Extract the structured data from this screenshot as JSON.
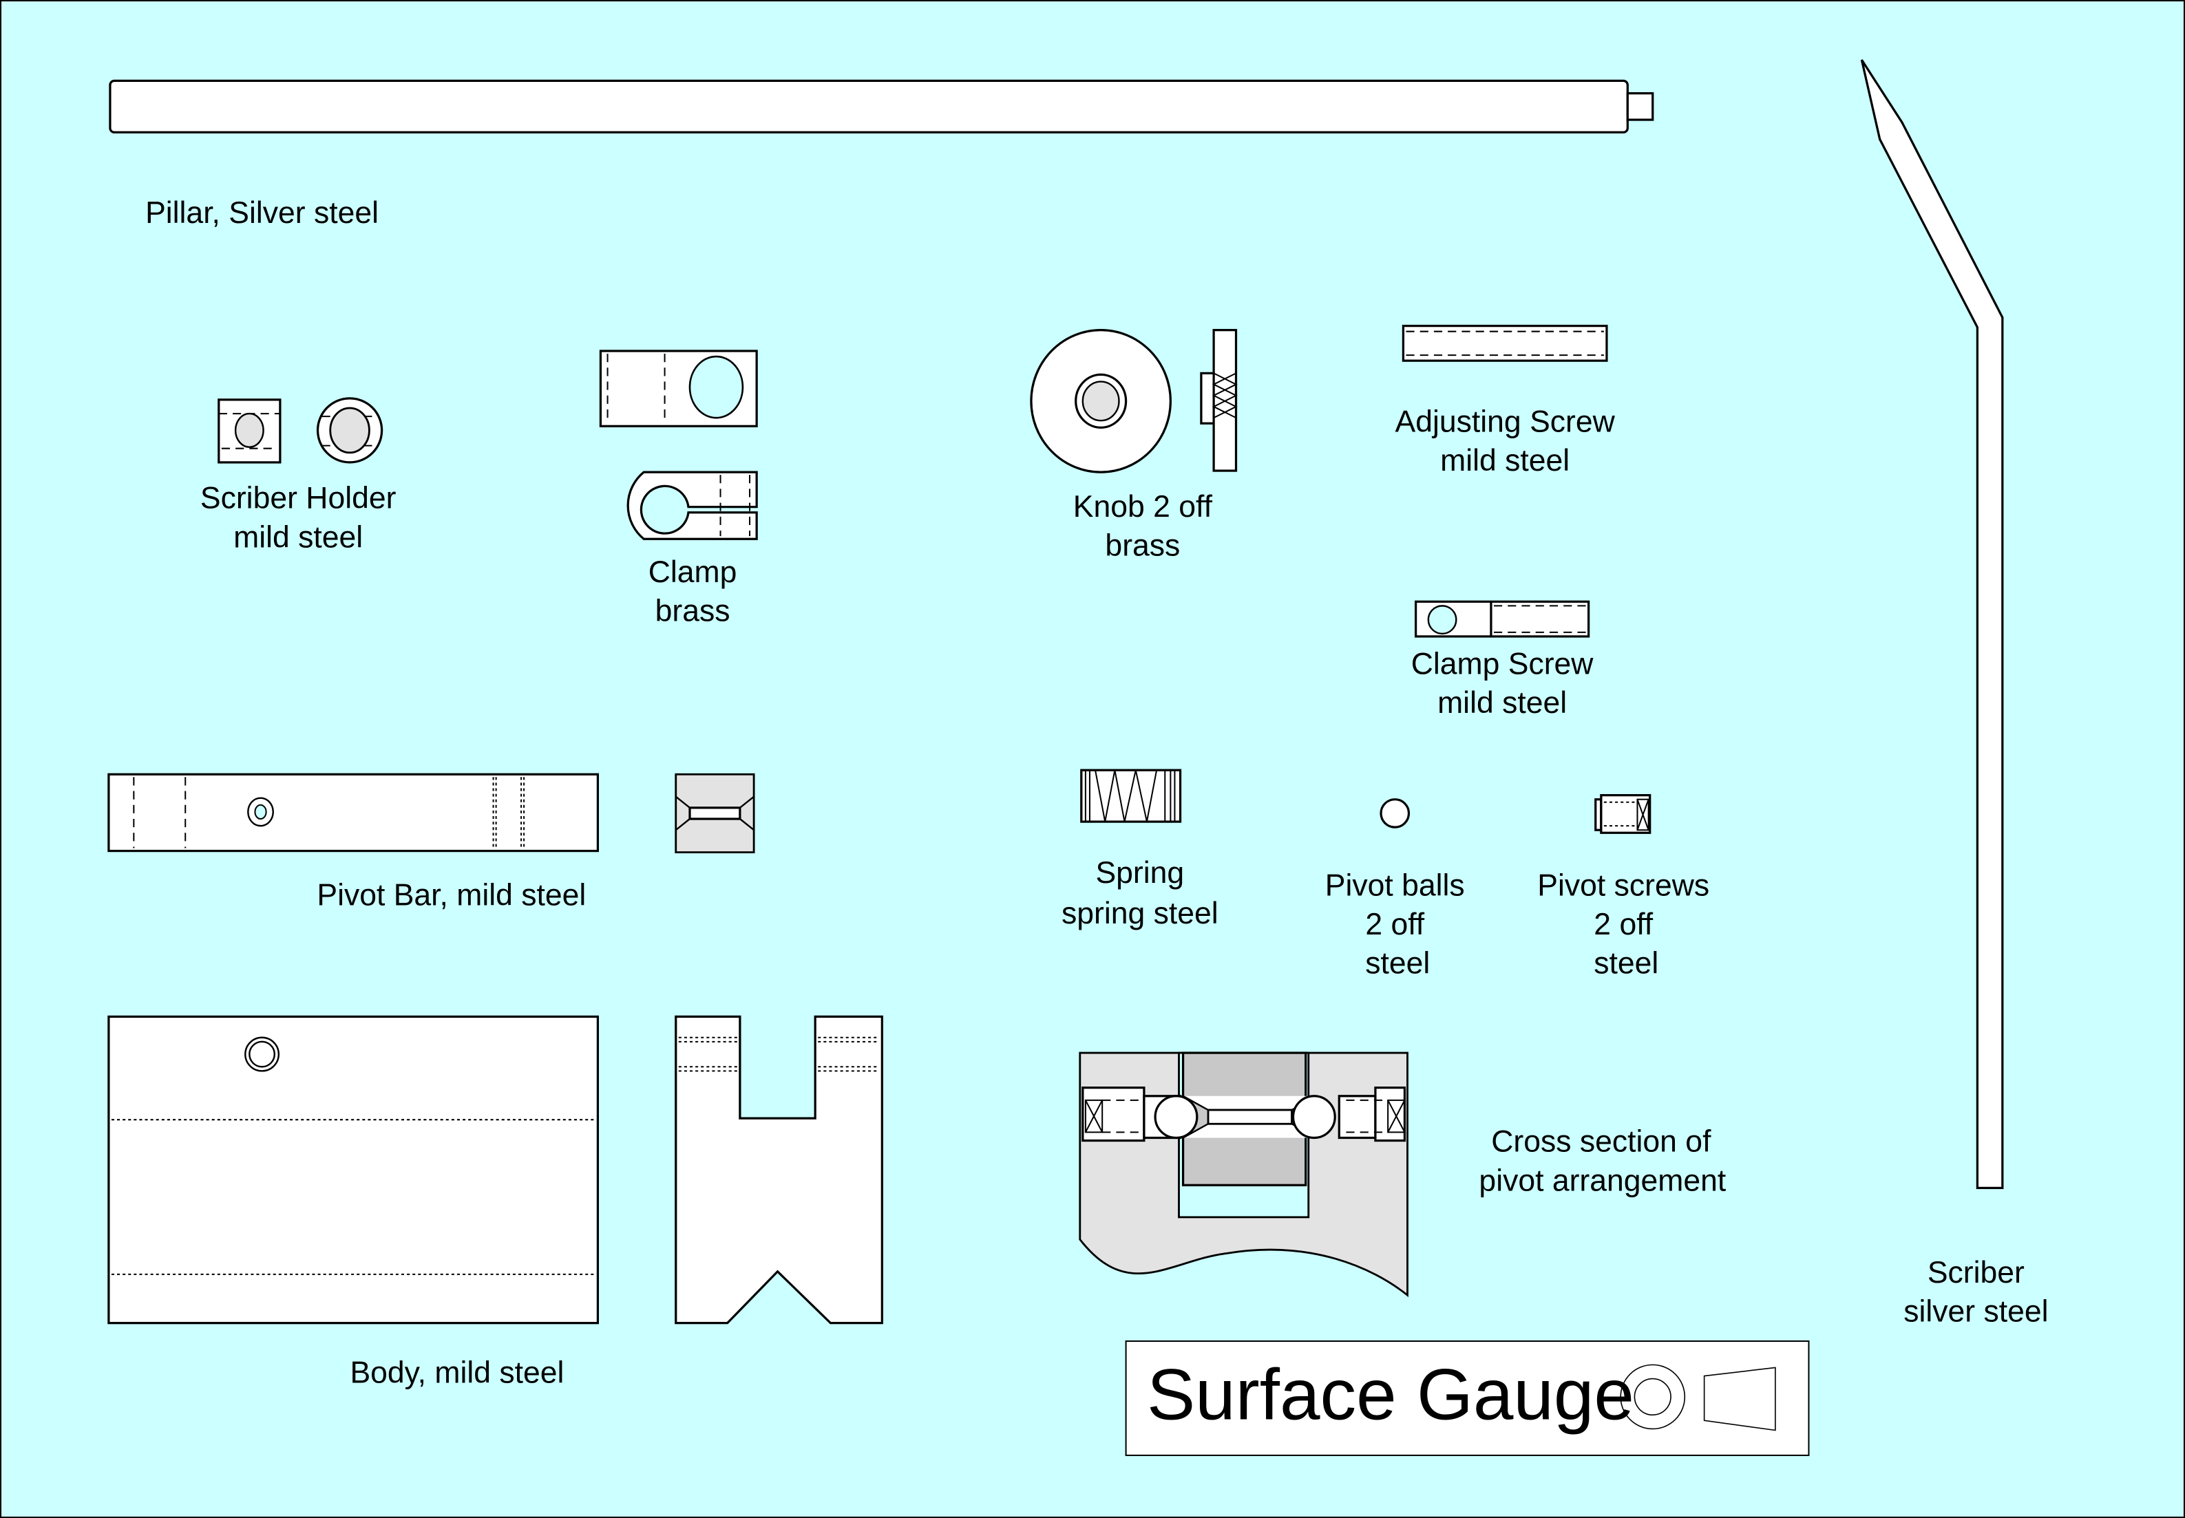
{
  "drawing": {
    "title": "Surface Gauge",
    "background_color": "#ccffff",
    "parts": [
      {
        "id": "pillar",
        "lines": [
          "Pillar, Silver steel"
        ]
      },
      {
        "id": "scriber-holder",
        "lines": [
          "Scriber Holder",
          "mild steel"
        ]
      },
      {
        "id": "clamp",
        "lines": [
          "Clamp",
          "brass"
        ]
      },
      {
        "id": "knob",
        "lines": [
          "Knob 2 off",
          "brass"
        ]
      },
      {
        "id": "adjusting-screw",
        "lines": [
          "Adjusting Screw",
          "mild steel"
        ]
      },
      {
        "id": "clamp-screw",
        "lines": [
          "Clamp Screw",
          "mild steel"
        ]
      },
      {
        "id": "pivot-bar",
        "lines": [
          "Pivot Bar, mild steel"
        ]
      },
      {
        "id": "spring",
        "lines": [
          "Spring",
          "spring steel"
        ]
      },
      {
        "id": "pivot-balls",
        "lines": [
          "Pivot balls",
          "2 off",
          "steel"
        ]
      },
      {
        "id": "pivot-screws",
        "lines": [
          "Pivot screws",
          "2 off",
          "steel"
        ]
      },
      {
        "id": "body",
        "lines": [
          "Body, mild steel"
        ]
      },
      {
        "id": "cross-section",
        "lines": [
          "Cross section of",
          "pivot arrangement"
        ]
      },
      {
        "id": "scriber",
        "lines": [
          "Scriber",
          "silver steel"
        ]
      }
    ]
  }
}
